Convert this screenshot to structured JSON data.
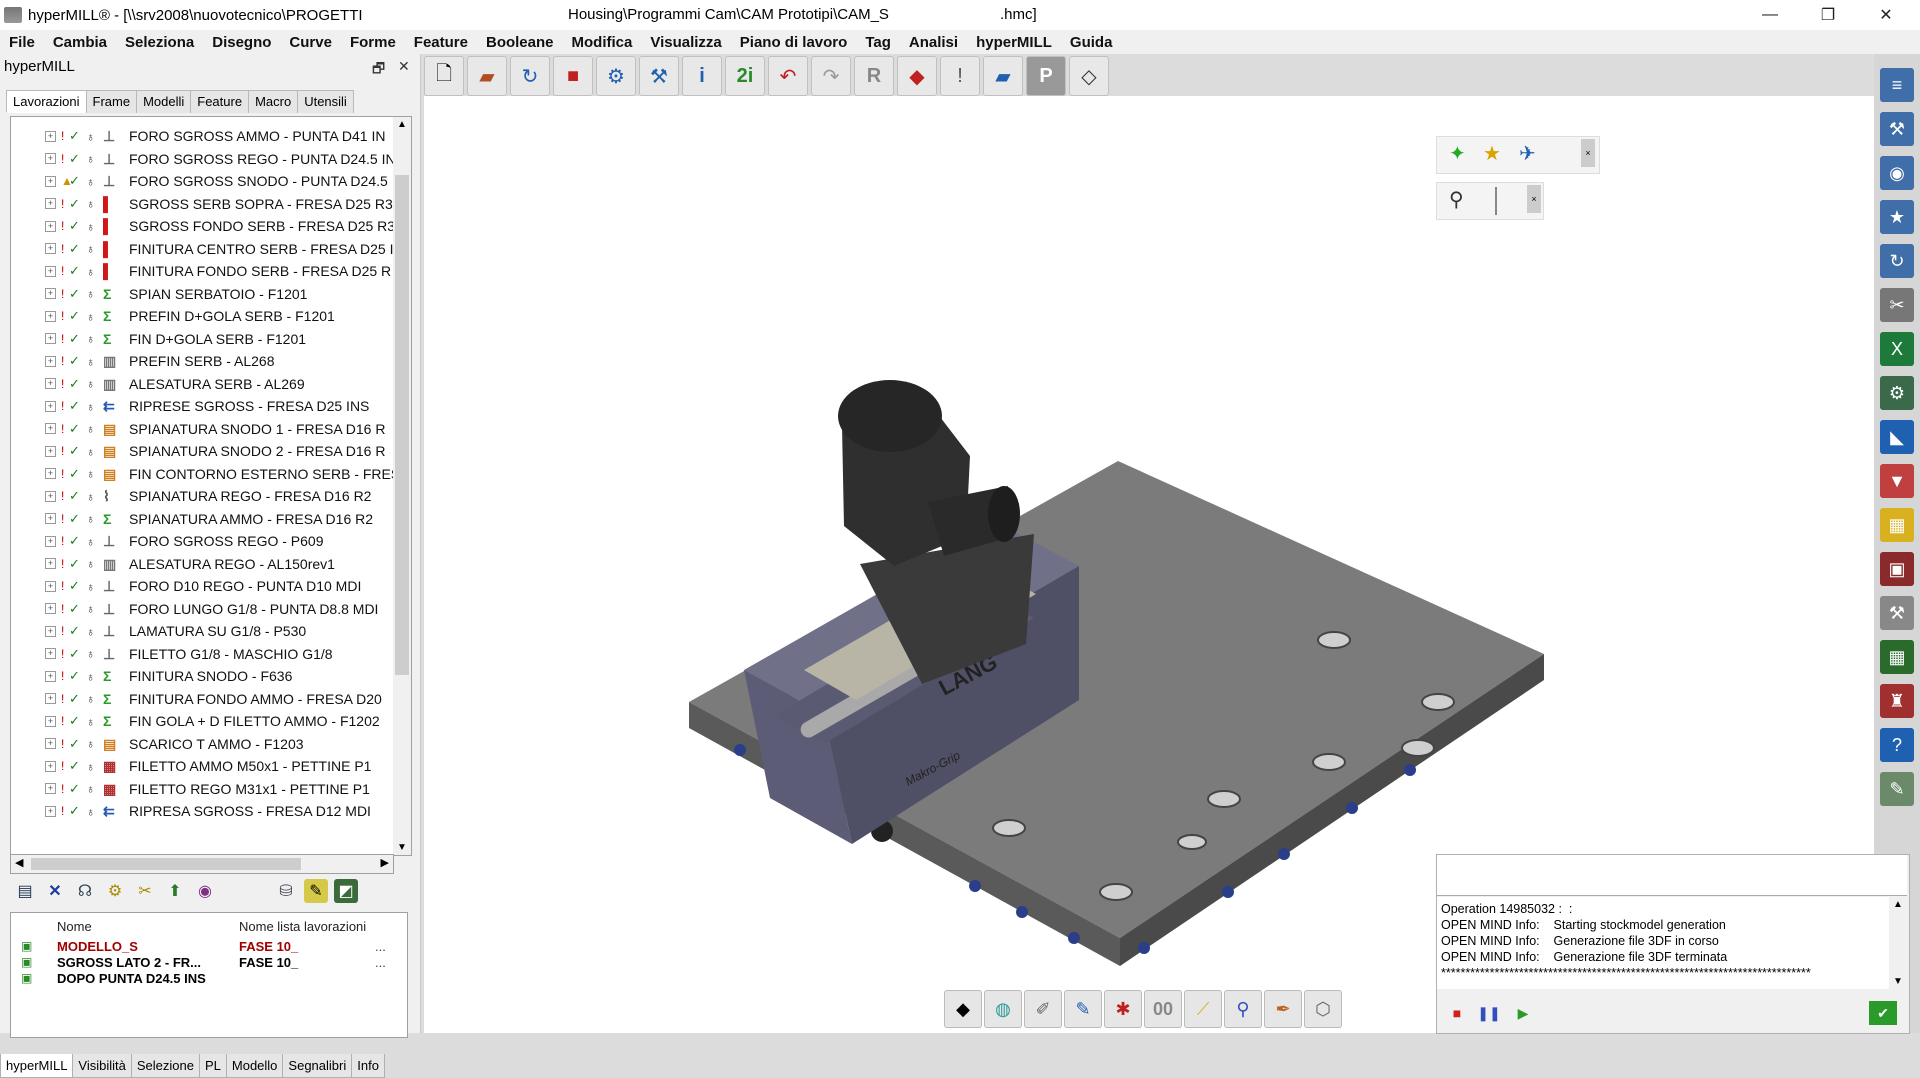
{
  "window": {
    "title": "hyperMILL® - [\\\\srv2008\\nuovotecnico\\PROGETTI",
    "path_mid": "Housing\\Programmi Cam\\CAM Prototipi\\CAM_S",
    "path_end": ".hmc]",
    "minimize": "—",
    "restore": "❐",
    "close": "✕"
  },
  "menu": [
    "File",
    "Cambia",
    "Seleziona",
    "Disegno",
    "Curve",
    "Forme",
    "Feature",
    "Booleane",
    "Modifica",
    "Visualizza",
    "Piano di lavoro",
    "Tag",
    "Analisi",
    "hyperMILL",
    "Guida"
  ],
  "panel": {
    "title": "hyperMILL",
    "pin": "🗗",
    "close": "✕",
    "tabs": [
      "Lavorazioni",
      "Frame",
      "Modelli",
      "Feature",
      "Macro",
      "Utensili"
    ],
    "active_tab": "Lavorazioni"
  },
  "tree_rows": [
    {
      "label": "FORO SGROSS AMMO - PUNTA D41 IN",
      "icon": "drill"
    },
    {
      "label": "FORO SGROSS REGO - PUNTA D24.5 IN",
      "icon": "drill"
    },
    {
      "label": "FORO SGROSS SNODO - PUNTA D24.5",
      "icon": "drill",
      "warn": true
    },
    {
      "label": "SGROSS SERB SOPRA - FRESA D25 R3",
      "icon": "pocket"
    },
    {
      "label": "SGROSS FONDO SERB - FRESA D25 R3",
      "icon": "pocket"
    },
    {
      "label": "FINITURA CENTRO SERB - FRESA D25 I",
      "icon": "pocket"
    },
    {
      "label": "FINITURA FONDO SERB - FRESA D25 R",
      "icon": "pocket"
    },
    {
      "label": "SPIAN SERBATOIO - F1201",
      "icon": "contour"
    },
    {
      "label": "PREFIN D+GOLA SERB - F1201",
      "icon": "contour"
    },
    {
      "label": "FIN D+GOLA SERB - F1201",
      "icon": "contour"
    },
    {
      "label": "PREFIN SERB - AL268",
      "icon": "bore"
    },
    {
      "label": "ALESATURA SERB - AL269",
      "icon": "bore"
    },
    {
      "label": "RIPRESE SGROSS - FRESA D25 INS",
      "icon": "rest"
    },
    {
      "label": "SPIANATURA SNODO 1 - FRESA D16 R",
      "icon": "face"
    },
    {
      "label": "SPIANATURA SNODO 2 - FRESA D16 R",
      "icon": "face"
    },
    {
      "label": "FIN CONTORNO ESTERNO SERB - FRES",
      "icon": "face"
    },
    {
      "label": "SPIANATURA REGO - FRESA D16 R2",
      "icon": "profile"
    },
    {
      "label": "SPIANATURA AMMO - FRESA D16 R2",
      "icon": "contour"
    },
    {
      "label": "FORO SGROSS REGO - P609",
      "icon": "drill"
    },
    {
      "label": "ALESATURA REGO - AL150rev1",
      "icon": "bore"
    },
    {
      "label": "FORO D10 REGO - PUNTA D10 MDI",
      "icon": "drill"
    },
    {
      "label": "FORO LUNGO G1/8 - PUNTA D8.8 MDI",
      "icon": "drill"
    },
    {
      "label": "LAMATURA SU G1/8 - P530",
      "icon": "drill"
    },
    {
      "label": "FILETTO G1/8 - MASCHIO G1/8",
      "icon": "drill"
    },
    {
      "label": "FINITURA SNODO - F636",
      "icon": "contour"
    },
    {
      "label": "FINITURA FONDO AMMO - FRESA D20",
      "icon": "contour"
    },
    {
      "label": "FIN GOLA + D FILETTO AMMO - F1202",
      "icon": "contour"
    },
    {
      "label": "SCARICO T AMMO - F1203",
      "icon": "face"
    },
    {
      "label": "FILETTO AMMO M50x1 - PETTINE P1",
      "icon": "thread"
    },
    {
      "label": "FILETTO REGO M31x1 - PETTINE P1",
      "icon": "thread"
    },
    {
      "label": "RIPRESA SGROSS - FRESA D12 MDI",
      "icon": "rest"
    }
  ],
  "project": {
    "col_name": "Nome",
    "col_list": "Nome lista lavorazioni",
    "rows": [
      {
        "name": "MODELLO_S",
        "list": "FASE 10_",
        "dots": "...",
        "color": "#a00000"
      },
      {
        "name": "SGROSS LATO 2 - FR...",
        "list": "FASE 10_",
        "dots": "...",
        "color": "#000000"
      },
      {
        "name": "DOPO PUNTA D24.5 INS",
        "list": "",
        "dots": "",
        "color": "#000000"
      }
    ]
  },
  "bottom_tabs": [
    "hyperMILL",
    "Visibilità",
    "Selezione",
    "PL",
    "Modello",
    "Segnalibri",
    "Info"
  ],
  "console": {
    "lines": [
      "Operation 14985032 :  :",
      "OPEN MIND Info:    Starting stockmodel generation",
      "OPEN MIND Info:    Generazione file 3DF in corso",
      "OPEN MIND Info:    Generazione file 3DF terminata",
      "****************************************************************************"
    ]
  },
  "model_text": {
    "brand": "LANG",
    "sub": "Makro-Grip"
  },
  "colors": {
    "plate": "#6f6f6f",
    "vise": "#6e6e86",
    "part": "#2f2f2f",
    "accent_red": "#cc1111"
  }
}
